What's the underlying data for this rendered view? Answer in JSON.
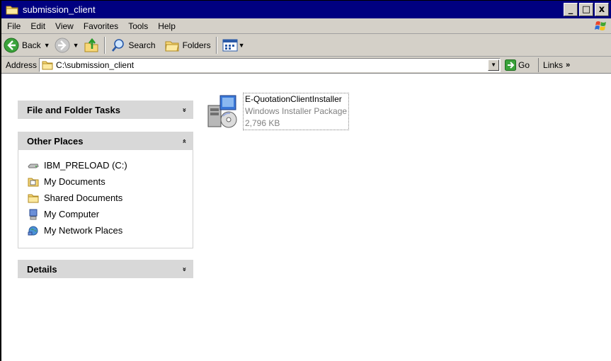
{
  "window": {
    "title": "submission_client"
  },
  "title_controls": {
    "minimize": "_",
    "maximize": "□",
    "close": "x"
  },
  "menu": [
    "File",
    "Edit",
    "View",
    "Favorites",
    "Tools",
    "Help"
  ],
  "toolbar": {
    "back_label": "Back",
    "search_label": "Search",
    "folders_label": "Folders"
  },
  "address": {
    "label": "Address",
    "value": "C:\\submission_client",
    "go_label": "Go",
    "links_label": "Links",
    "links_chevron": "»"
  },
  "sidebar": {
    "file_folder_tasks": {
      "title": "File and Folder Tasks",
      "toggle": "»"
    },
    "other_places": {
      "title": "Other Places",
      "toggle": "«",
      "items": [
        {
          "label": "IBM_PRELOAD (C:)",
          "icon": "drive-icon"
        },
        {
          "label": "My Documents",
          "icon": "my-documents-icon"
        },
        {
          "label": "Shared Documents",
          "icon": "folder-icon"
        },
        {
          "label": "My Computer",
          "icon": "my-computer-icon"
        },
        {
          "label": "My Network Places",
          "icon": "network-places-icon"
        }
      ]
    },
    "details": {
      "title": "Details",
      "toggle": "»"
    }
  },
  "files": [
    {
      "name": "E-QuotationClientInstaller",
      "type": "Windows Installer Package",
      "size": "2,796 KB"
    }
  ]
}
